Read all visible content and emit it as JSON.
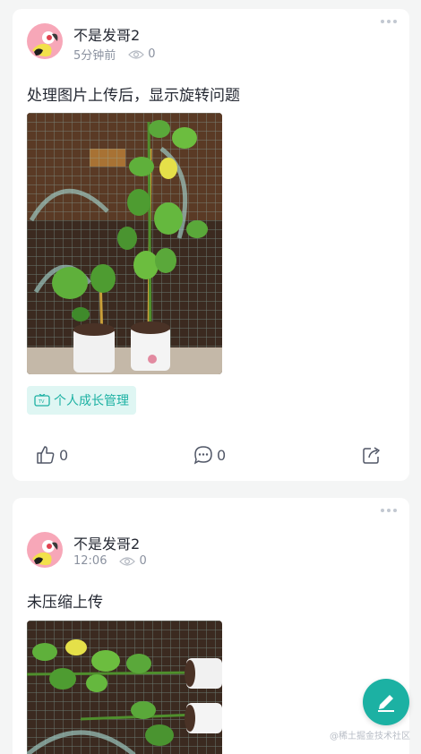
{
  "colors": {
    "accent": "#1cb1a3",
    "background": "#f4f5f5",
    "card": "#ffffff",
    "muted": "#8a919f"
  },
  "posts": [
    {
      "author": "不是发哥2",
      "time": "5分钟前",
      "views": "0",
      "content": "处理图片上传后，显示旋转问题",
      "tag": "个人成长管理",
      "likes": "0",
      "comments": "0"
    },
    {
      "author": "不是发哥2",
      "time": "12:06",
      "views": "0",
      "content": "未压缩上传"
    }
  ],
  "fab": {
    "icon": "pencil-icon"
  },
  "watermark": "@稀土掘金技术社区"
}
